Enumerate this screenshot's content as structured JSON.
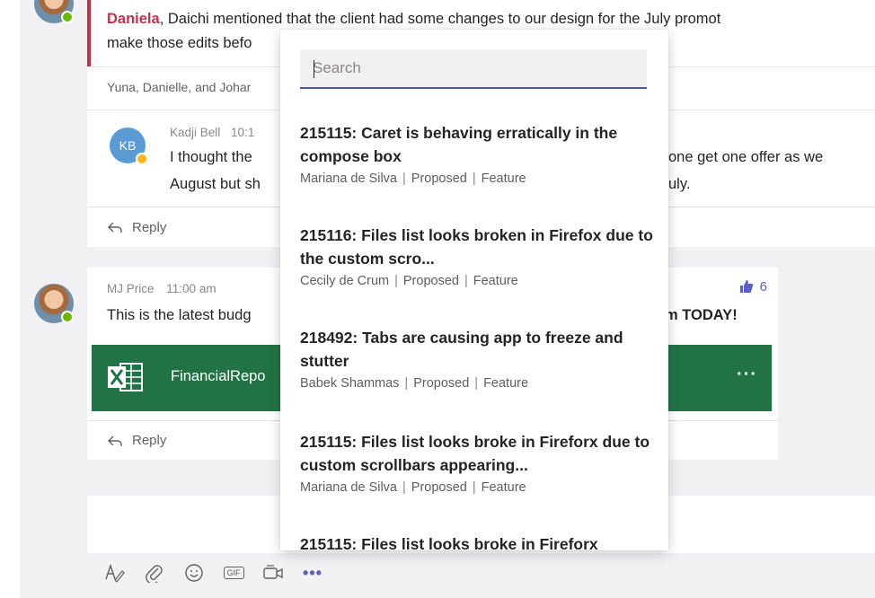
{
  "thread1": {
    "mention": "Daniela",
    "text_line1": ", Daichi mentioned that the client had some changes to our design for the July promot",
    "text_line2": "make those edits befo",
    "replies_summary": "Yuna, Danielle, and Johar",
    "reply": {
      "avatar_initials": "KB",
      "author": "Kadji Bell",
      "time": "10:1",
      "line1_left": "I thought the",
      "line1_right": "one get one offer as we",
      "line2_left": "August but sh",
      "line2_right": "uly."
    },
    "reply_label": "Reply"
  },
  "thread2": {
    "author": "MJ Price",
    "time": "11:00 am",
    "text_left": "This is the latest budg",
    "text_right": "m TODAY!",
    "likes": "6",
    "file": {
      "name": "FinancialRepo",
      "more": "···"
    },
    "reply_label": "Reply"
  },
  "popup": {
    "search_placeholder": "Search",
    "results": [
      {
        "title": "215115: Caret is behaving erratically in the compose box",
        "assignee": "Mariana de Silva",
        "state": "Proposed",
        "type": "Feature"
      },
      {
        "title": "215116: Files list looks broken in Firefox due to the custom scro...",
        "assignee": "Cecily de Crum",
        "state": "Proposed",
        "type": "Feature"
      },
      {
        "title": "218492: Tabs are causing app to freeze and stutter",
        "assignee": "Babek Shammas",
        "state": "Proposed",
        "type": "Feature"
      },
      {
        "title": "215115: Files list looks broke in Fireforx due to custom scrollbars appearing...",
        "assignee": "Mariana de Silva",
        "state": "Proposed",
        "type": "Feature"
      },
      {
        "title": "215115: Files list looks broke in Fireforx",
        "assignee": "",
        "state": "",
        "type": ""
      }
    ],
    "separator": "|"
  },
  "toolbar": {
    "icons": [
      "format-icon",
      "attach-icon",
      "emoji-icon",
      "gif-icon",
      "meet-now-icon",
      "more-options-icon"
    ],
    "gif_label": "GIF",
    "more_label": "•••"
  },
  "colors": {
    "accent": "#5b5fc7",
    "mention": "#c4314b",
    "excel_green": "#217346",
    "presence_available": "#6bb700",
    "presence_away": "#fdb913"
  }
}
